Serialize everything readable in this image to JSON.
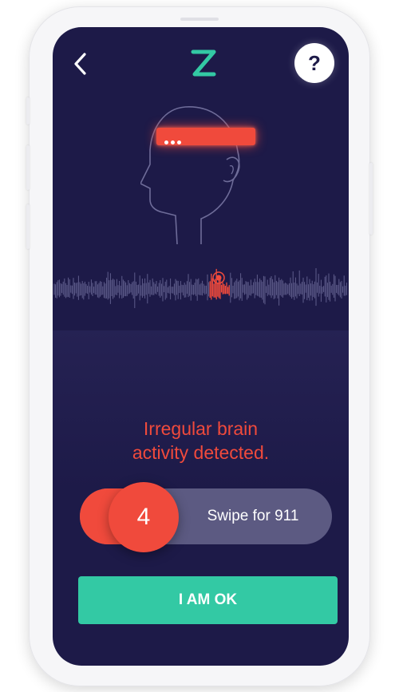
{
  "header": {
    "back_icon": "chevron-left-icon",
    "logo_icon": "z-logo-icon",
    "help_label": "?"
  },
  "alert": {
    "message": "Irregular brain\nactivity detected."
  },
  "swipe": {
    "countdown": "4",
    "label": "Swipe for 911"
  },
  "actions": {
    "ok_label": "I AM OK"
  },
  "colors": {
    "background": "#1d1a48",
    "alert": "#f04a3c",
    "accent": "#33c9a4",
    "track": "#5c5a82",
    "logo": "#33c9a4"
  }
}
